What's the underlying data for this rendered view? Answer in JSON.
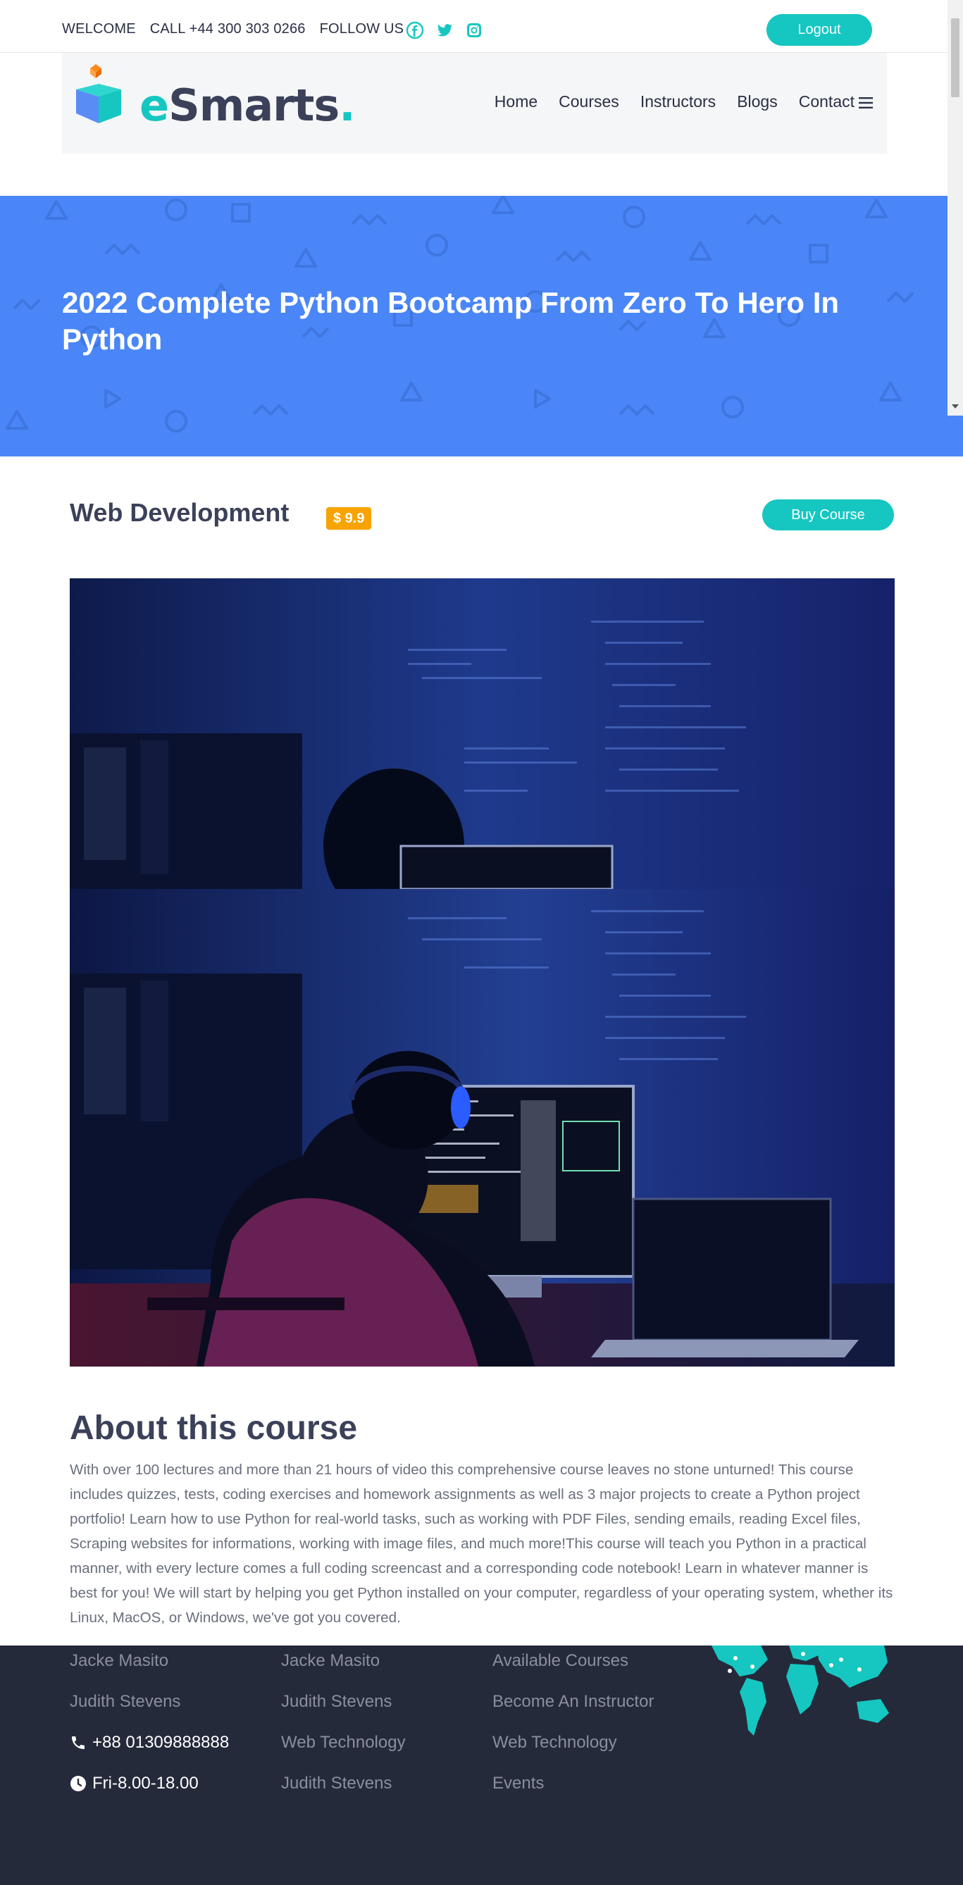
{
  "topbar": {
    "links": [
      "WELCOME",
      "CALL +44 300 303 0266",
      "FOLLOW US"
    ],
    "social": [
      "facebook-icon",
      "twitter-icon",
      "instagram-icon"
    ],
    "logout_label": "Logout"
  },
  "brand": {
    "prefix": "e",
    "name": "Smarts",
    "suffix": "."
  },
  "nav": {
    "items": [
      "Home",
      "Courses",
      "Instructors",
      "Blogs",
      "Contact"
    ],
    "menu_icon": "hamburger-icon"
  },
  "hero": {
    "title": "2022 Complete Python Bootcamp From Zero To Hero In Python"
  },
  "course": {
    "category": "Web Development",
    "price": "$ 9.9",
    "buy_label": "Buy Course"
  },
  "about": {
    "title": "About this course",
    "body": "With over 100 lectures and more than 21 hours of video this comprehensive course leaves no stone unturned! This course includes quizzes, tests, coding exercises and homework assignments as well as 3 major projects to create a Python project portfolio! Learn how to use Python for real-world tasks, such as working with PDF Files, sending emails, reading Excel files, Scraping websites for informations, working with image files, and much more!This course will teach you Python in a practical manner, with every lecture comes a full coding screencast and a corresponding code notebook! Learn in whatever manner is best for you! We will start by helping you get Python installed on your computer, regardless of your operating system, whether its Linux, MacOS, or Windows, we've got you covered."
  },
  "footer": {
    "col1": [
      "Jacke Masito",
      "Judith Stevens"
    ],
    "phone": "+88 01309888888",
    "hours": "Fri-8.00-18.00",
    "col2": [
      "Jacke Masito",
      "Judith Stevens",
      "Web Technology",
      "Judith Stevens"
    ],
    "col3": [
      "Available Courses",
      "Become An Instructor",
      "Web Technology",
      "Events"
    ]
  },
  "colors": {
    "accent": "#16c6c1",
    "hero_bg": "#4a86f7",
    "price_badge": "#f7a400",
    "footer_bg": "#252a3a",
    "heading": "#3b4159"
  }
}
